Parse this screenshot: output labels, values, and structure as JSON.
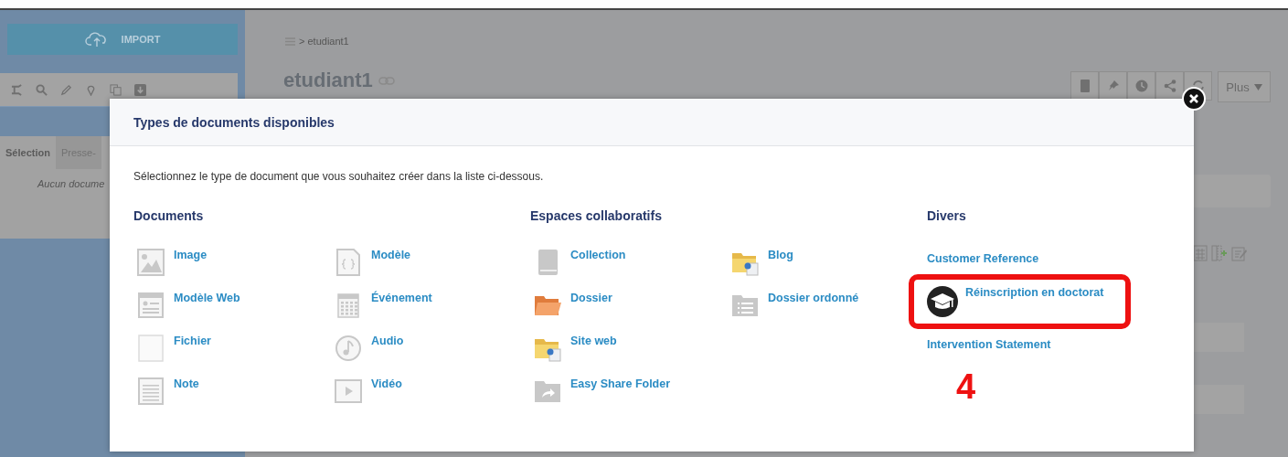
{
  "sidebar": {
    "import_button": "IMPORT",
    "tabs": [
      {
        "label": "Sélection",
        "selected": true
      },
      {
        "label": "Presse-",
        "selected": false
      }
    ],
    "empty_text": "Aucun docume"
  },
  "main": {
    "breadcrumb": "> etudiant1",
    "title": "etudiant1",
    "more_button": "Plus"
  },
  "dialog": {
    "title": "Types de documents disponibles",
    "intro": "Sélectionnez le type de document que vous souhaitez créer dans la liste ci-dessous.",
    "sections": [
      {
        "title": "Documents",
        "columns": [
          [
            {
              "label": "Image",
              "kind": "image"
            },
            {
              "label": "Modèle Web",
              "kind": "webpage"
            },
            {
              "label": "Fichier",
              "kind": "file"
            },
            {
              "label": "Note",
              "kind": "note"
            }
          ],
          [
            {
              "label": "Modèle",
              "kind": "template"
            },
            {
              "label": "Événement",
              "kind": "calendar"
            },
            {
              "label": "Audio",
              "kind": "audio"
            },
            {
              "label": "Vidéo",
              "kind": "video"
            }
          ]
        ]
      },
      {
        "title": "Espaces collaboratifs",
        "columns": [
          [
            {
              "label": "Collection",
              "kind": "book"
            },
            {
              "label": "Dossier",
              "kind": "folder"
            },
            {
              "label": "Site web",
              "kind": "web-folder"
            },
            {
              "label": "Easy Share Folder",
              "kind": "share-folder"
            }
          ],
          [
            {
              "label": "Blog",
              "kind": "blog-folder"
            },
            {
              "label": "Dossier ordonné",
              "kind": "list-folder"
            }
          ]
        ]
      },
      {
        "title": "Divers",
        "columns": [
          [
            {
              "label": "Customer Reference",
              "kind": "plain",
              "highlighted": false
            },
            {
              "label": "Réinscription en doctorat",
              "kind": "cap",
              "highlighted": true
            },
            {
              "label": "Intervention Statement",
              "kind": "plain",
              "highlighted": false
            }
          ]
        ]
      }
    ]
  },
  "annotation": {
    "label": "4"
  }
}
